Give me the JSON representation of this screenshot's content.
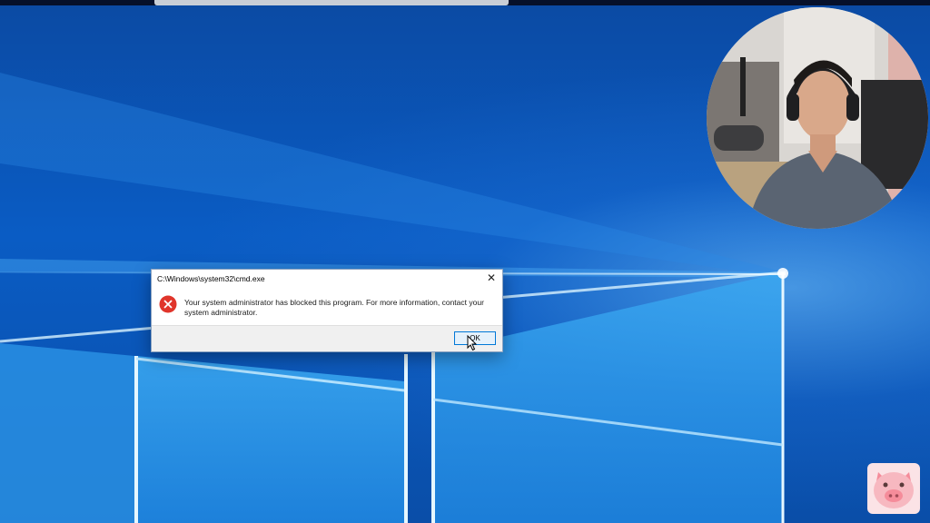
{
  "dialog": {
    "title": "C:\\Windows\\system32\\cmd.exe",
    "close_label": "✕",
    "message": "Your system administrator has blocked this program. For more information, contact your system administrator.",
    "ok_label": "OK",
    "icon": "error-icon"
  },
  "colors": {
    "desktop_blue": "#0a5cc4",
    "error_red": "#e0352b",
    "button_accent": "#0078d7"
  },
  "overlays": {
    "webcam": "presenter-webcam",
    "logo": "pig-logo"
  }
}
